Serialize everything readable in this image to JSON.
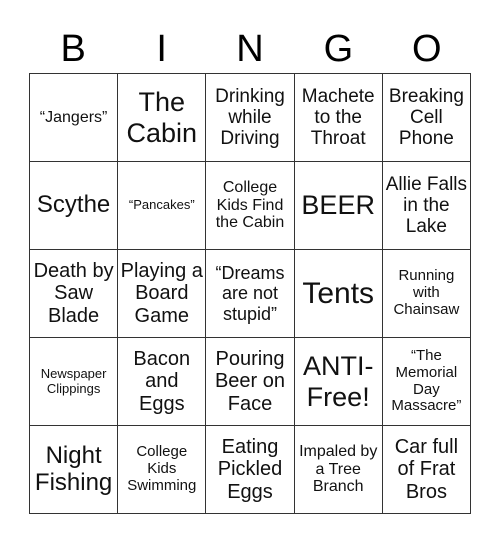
{
  "title_letters": [
    "B",
    "I",
    "N",
    "G",
    "O"
  ],
  "cells": [
    [
      "“Jangers”",
      "The Cabin",
      "Drinking while Driving",
      "Machete to the Throat",
      "Breaking Cell Phone"
    ],
    [
      "Scythe",
      "“Pancakes”",
      "College Kids Find the Cabin",
      "BEER",
      "Allie Falls in the Lake"
    ],
    [
      "Death by Saw Blade",
      "Playing a Board Game",
      "“Dreams are not stupid”",
      "Tents",
      "Running with Chainsaw"
    ],
    [
      "Newspaper Clippings",
      "Bacon and Eggs",
      "Pouring Beer on Face",
      "ANTI-Free!",
      "“The Memorial Day Massacre”"
    ],
    [
      "Night Fishing",
      "College Kids Swimming",
      "Eating Pickled Eggs",
      "Impaled by a Tree Branch",
      "Car full of Frat Bros"
    ]
  ]
}
